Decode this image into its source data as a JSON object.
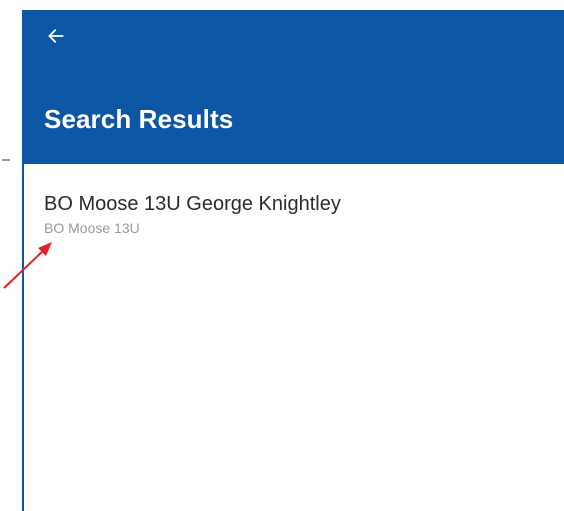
{
  "header": {
    "back_icon": "arrow-left-icon",
    "title": "Search Results",
    "background_color": "#0d56a6",
    "title_color": "#ffffff"
  },
  "results": [
    {
      "title": "BO Moose 13U George Knightley",
      "subtitle": "BO Moose 13U"
    }
  ],
  "annotation": {
    "arrow_color": "#e0202a"
  }
}
